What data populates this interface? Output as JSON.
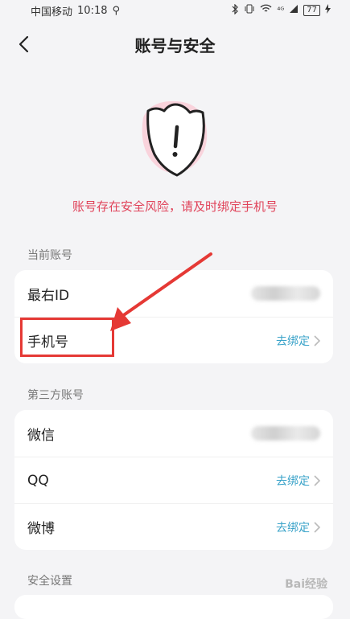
{
  "status_bar": {
    "carrier": "中国移动",
    "time": "10:18",
    "usb_glyph": "⚲",
    "signal": "⁴ᴳ",
    "battery": "77"
  },
  "nav": {
    "title": "账号与安全"
  },
  "warning": "账号存在安全风险，请及时绑定手机号",
  "current_account": {
    "label": "当前账号",
    "rows": [
      {
        "label": "最右ID"
      },
      {
        "label": "手机号",
        "action": "去绑定"
      }
    ]
  },
  "third_party": {
    "label": "第三方账号",
    "rows": [
      {
        "label": "微信"
      },
      {
        "label": "QQ",
        "action": "去绑定"
      },
      {
        "label": "微博",
        "action": "去绑定"
      }
    ]
  },
  "security": {
    "label": "安全设置"
  },
  "watermark": "Bai经验",
  "colors": {
    "accent": "#3aa3c9",
    "warning": "#e0435a",
    "annotation": "#e53935"
  }
}
